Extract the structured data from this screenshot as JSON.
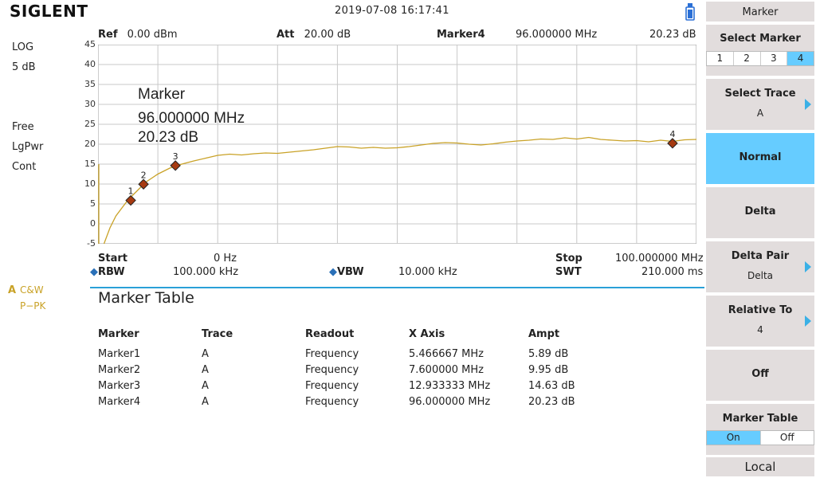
{
  "header": {
    "logo": "SIGLENT",
    "datetime": "2019-07-08   16:17:41"
  },
  "left": {
    "scale_type": "LOG",
    "scale_div": "5 dB",
    "trig": "Free",
    "detector": "LgPwr",
    "sweep": "Cont",
    "trace_letter": "A",
    "trace_mode1": "C&W",
    "trace_mode2": "P−PK"
  },
  "params": {
    "ref_label": "Ref",
    "ref_value": "0.00 dBm",
    "att_label": "Att",
    "att_value": "20.00 dB",
    "marker_label": "Marker4",
    "marker_freq": "96.000000 MHz",
    "marker_amp": "20.23 dB"
  },
  "readout": {
    "title": "Marker",
    "freq": "96.000000 MHz",
    "amp": "20.23 dB"
  },
  "yaxis": {
    "ticks": [
      "45",
      "40",
      "35",
      "30",
      "25",
      "20",
      "15",
      "10",
      "5",
      "0",
      "-5"
    ],
    "min": -5,
    "max": 45
  },
  "xaxis": {
    "min_mhz": 0,
    "max_mhz": 100
  },
  "trace": {
    "color": "#c9a227",
    "points": [
      [
        1.0,
        -5
      ],
      [
        2.0,
        -1
      ],
      [
        3.0,
        2
      ],
      [
        4.0,
        4
      ],
      [
        5.0,
        6
      ],
      [
        6.0,
        7.5
      ],
      [
        7.0,
        9
      ],
      [
        8.0,
        10.5
      ],
      [
        9.0,
        11.5
      ],
      [
        10.0,
        12.5
      ],
      [
        12.0,
        14
      ],
      [
        14.0,
        15
      ],
      [
        16.0,
        15.8
      ],
      [
        18.0,
        16.5
      ],
      [
        20.0,
        17.2
      ],
      [
        22.0,
        17.5
      ],
      [
        24.0,
        17.3
      ],
      [
        26.0,
        17.6
      ],
      [
        28.0,
        17.8
      ],
      [
        30.0,
        17.7
      ],
      [
        32.0,
        18
      ],
      [
        34.0,
        18.3
      ],
      [
        36.0,
        18.6
      ],
      [
        38.0,
        19
      ],
      [
        40.0,
        19.4
      ],
      [
        42.0,
        19.3
      ],
      [
        44.0,
        19
      ],
      [
        46.0,
        19.2
      ],
      [
        48.0,
        19
      ],
      [
        50.0,
        19.1
      ],
      [
        52.0,
        19.4
      ],
      [
        54.0,
        19.8
      ],
      [
        56.0,
        20.2
      ],
      [
        58.0,
        20.4
      ],
      [
        60.0,
        20.3
      ],
      [
        62.0,
        20
      ],
      [
        64.0,
        19.8
      ],
      [
        66.0,
        20.1
      ],
      [
        68.0,
        20.5
      ],
      [
        70.0,
        20.8
      ],
      [
        72.0,
        21
      ],
      [
        74.0,
        21.3
      ],
      [
        76.0,
        21.2
      ],
      [
        78.0,
        21.6
      ],
      [
        80.0,
        21.3
      ],
      [
        82.0,
        21.7
      ],
      [
        84.0,
        21.2
      ],
      [
        86.0,
        21
      ],
      [
        88.0,
        20.8
      ],
      [
        90.0,
        20.9
      ],
      [
        92.0,
        20.6
      ],
      [
        94.0,
        21
      ],
      [
        96.0,
        20.7
      ],
      [
        98.0,
        21.1
      ],
      [
        100.0,
        21.2
      ]
    ]
  },
  "markers": [
    {
      "n": "1",
      "x": 5.466667,
      "y": 5.89
    },
    {
      "n": "2",
      "x": 7.6,
      "y": 9.95
    },
    {
      "n": "3",
      "x": 12.933333,
      "y": 14.63
    },
    {
      "n": "4",
      "x": 96.0,
      "y": 20.23
    }
  ],
  "bottom": {
    "start_label": "Start",
    "start_value": "0 Hz",
    "stop_label": "Stop",
    "stop_value": "100.000000 MHz",
    "rbw_label": "RBW",
    "rbw_value": "100.000 kHz",
    "vbw_label": "VBW",
    "vbw_value": "10.000 kHz",
    "swt_label": "SWT",
    "swt_value": "210.000 ms"
  },
  "marker_table": {
    "title": "Marker Table",
    "headers": [
      "Marker",
      "Trace",
      "Readout",
      "X Axis",
      "Ampt"
    ],
    "rows": [
      [
        "Marker1",
        "A",
        "Frequency",
        "5.466667 MHz",
        "5.89 dB"
      ],
      [
        "Marker2",
        "A",
        "Frequency",
        "7.600000 MHz",
        "9.95 dB"
      ],
      [
        "Marker3",
        "A",
        "Frequency",
        "12.933333 MHz",
        "14.63 dB"
      ],
      [
        "Marker4",
        "A",
        "Frequency",
        "96.000000 MHz",
        "20.23 dB"
      ]
    ]
  },
  "panel": {
    "title": "Marker",
    "select_marker": "Select Marker",
    "marker_options": [
      "1",
      "2",
      "3",
      "4"
    ],
    "select_trace": "Select Trace",
    "select_trace_value": "A",
    "normal": "Normal",
    "delta": "Delta",
    "delta_pair": "Delta Pair",
    "delta_pair_value": "Delta",
    "relative_to": "Relative To",
    "relative_to_value": "4",
    "off": "Off",
    "marker_table": "Marker Table",
    "on_label": "On",
    "off_label": "Off",
    "local": "Local"
  }
}
